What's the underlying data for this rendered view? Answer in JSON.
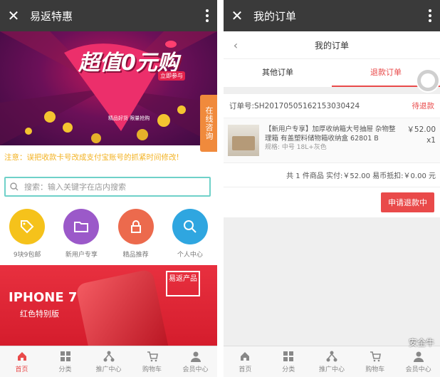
{
  "left": {
    "title": "易返特惠",
    "banner": {
      "headline": "超值0元购",
      "tag": "立即参与",
      "sub": "精品好货 限量抢购"
    },
    "side_tab": "在线咨询",
    "notice": "注意：误把收款卡号改成支付宝账号的抓紧时间修改!",
    "search_placeholder": "搜索：输入关键字在店内搜索",
    "categories": [
      {
        "label": "9块9包邮",
        "color": "#f5c21b",
        "icon": "tag-icon"
      },
      {
        "label": "新用户专享",
        "color": "#9b59c9",
        "icon": "folder-icon"
      },
      {
        "label": "精品推荐",
        "color": "#ec6a4d",
        "icon": "lock-icon"
      },
      {
        "label": "个人中心",
        "color": "#2fa6e0",
        "icon": "search-icon"
      }
    ],
    "promo": {
      "title": "IPHONE 7",
      "subtitle": "红色特别版",
      "brand": "易返产品"
    }
  },
  "right": {
    "title": "我的订单",
    "subtitle": "我的订单",
    "tabs": [
      "其他订单",
      "退款订单"
    ],
    "order": {
      "number_label": "订单号:",
      "number": "SH20170505162153030424",
      "status": "待退款",
      "item_name": "【新用户专享】加厚收纳箱大号抽屉 杂物整理箱 有盖塑料储物箱收纳盒 62801 B",
      "item_spec": "规格: 中号 18L+灰色",
      "price": "￥52.00",
      "qty": "x1",
      "summary": "共 1 件商品 实付:￥52.00 易币抵扣:￥0.00 元",
      "action": "申请退款中"
    },
    "watermark": "安全牛"
  },
  "tabbar": [
    {
      "label": "首页",
      "icon": "home-icon"
    },
    {
      "label": "分类",
      "icon": "grid-icon"
    },
    {
      "label": "推广中心",
      "icon": "network-icon"
    },
    {
      "label": "购物车",
      "icon": "cart-icon"
    },
    {
      "label": "会员中心",
      "icon": "user-icon"
    }
  ]
}
